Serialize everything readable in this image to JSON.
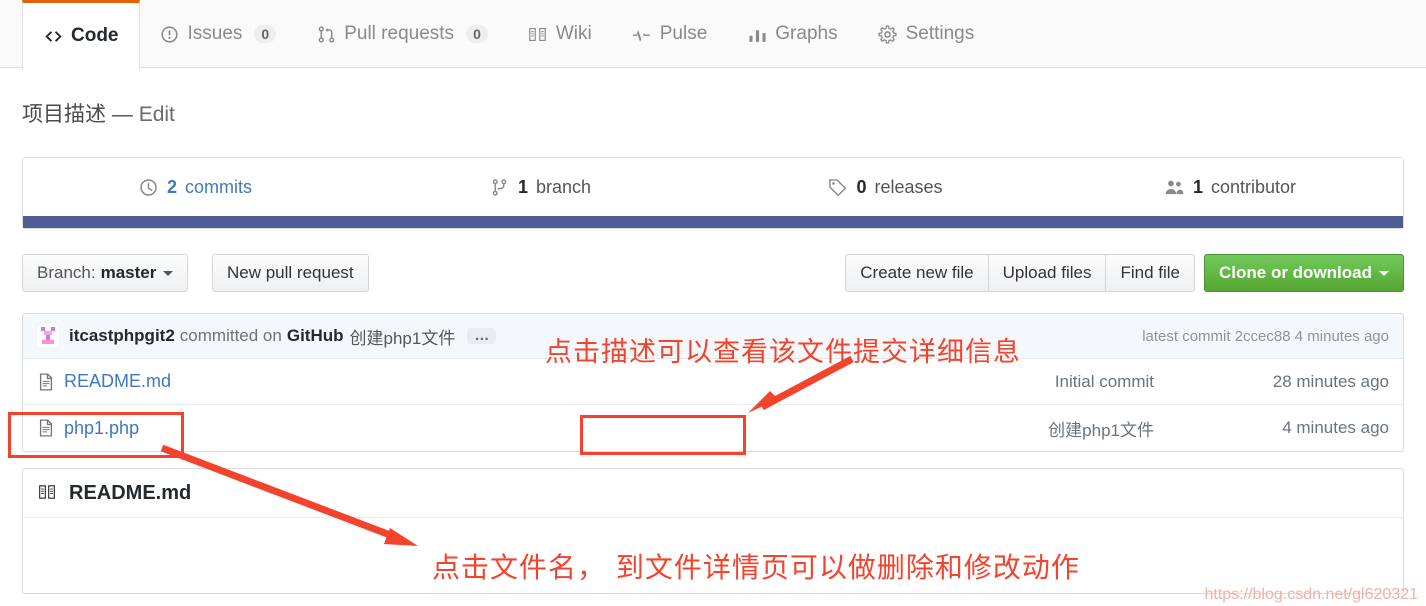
{
  "tabs": [
    {
      "id": "code",
      "label": "Code",
      "icon": "code-icon",
      "count": null,
      "selected": true
    },
    {
      "id": "issues",
      "label": "Issues",
      "icon": "issue-opened-icon",
      "count": "0",
      "selected": false
    },
    {
      "id": "pull-requests",
      "label": "Pull requests",
      "icon": "git-pull-request-icon",
      "count": "0",
      "selected": false
    },
    {
      "id": "wiki",
      "label": "Wiki",
      "icon": "book-icon",
      "count": null,
      "selected": false
    },
    {
      "id": "pulse",
      "label": "Pulse",
      "icon": "pulse-icon",
      "count": null,
      "selected": false
    },
    {
      "id": "graphs",
      "label": "Graphs",
      "icon": "graph-icon",
      "count": null,
      "selected": false
    },
    {
      "id": "settings",
      "label": "Settings",
      "icon": "gear-icon",
      "count": null,
      "selected": false
    }
  ],
  "description": {
    "text": "项目描述",
    "separator": "—",
    "edit_label": "Edit"
  },
  "numbers": [
    {
      "id": "commits",
      "icon": "history-icon",
      "count": "2",
      "label": "commits",
      "is_link": true
    },
    {
      "id": "branches",
      "icon": "git-branch-icon",
      "count": "1",
      "label": "branch",
      "is_link": false
    },
    {
      "id": "releases",
      "icon": "tag-icon",
      "count": "0",
      "label": "releases",
      "is_link": false
    },
    {
      "id": "contributors",
      "icon": "organization-icon",
      "count": "1",
      "label": "contributor",
      "is_link": false
    }
  ],
  "language_bar_color": "#4f5d95",
  "toolbar": {
    "branch_prefix": "Branch:",
    "branch_name": "master",
    "new_pull_request": "New pull request",
    "create_new_file": "Create new file",
    "upload_files": "Upload files",
    "find_file": "Find file",
    "clone_or_download": "Clone or download"
  },
  "commit_bar": {
    "author": "itcastphpgit2",
    "verb": "committed on",
    "platform": "GitHub",
    "message": "创建php1文件",
    "ellipsis": "…",
    "latest_label": "latest commit",
    "sha": "2ccec88",
    "time": "4 minutes ago"
  },
  "files": [
    {
      "name": "README.md",
      "icon": "file-icon",
      "message": "Initial commit",
      "time": "28 minutes ago"
    },
    {
      "name": "php1.php",
      "icon": "file-icon",
      "message": "创建php1文件",
      "time": "4 minutes ago"
    }
  ],
  "readme": {
    "icon": "book-icon",
    "title": "README.md"
  },
  "annotations": {
    "top": "点击描述可以查看该文件提交详细信息",
    "bottom": "点击文件名， 到文件详情页可以做删除和修改动作",
    "color": "#f4432c"
  },
  "watermark": "https://blog.csdn.net/gl620321"
}
